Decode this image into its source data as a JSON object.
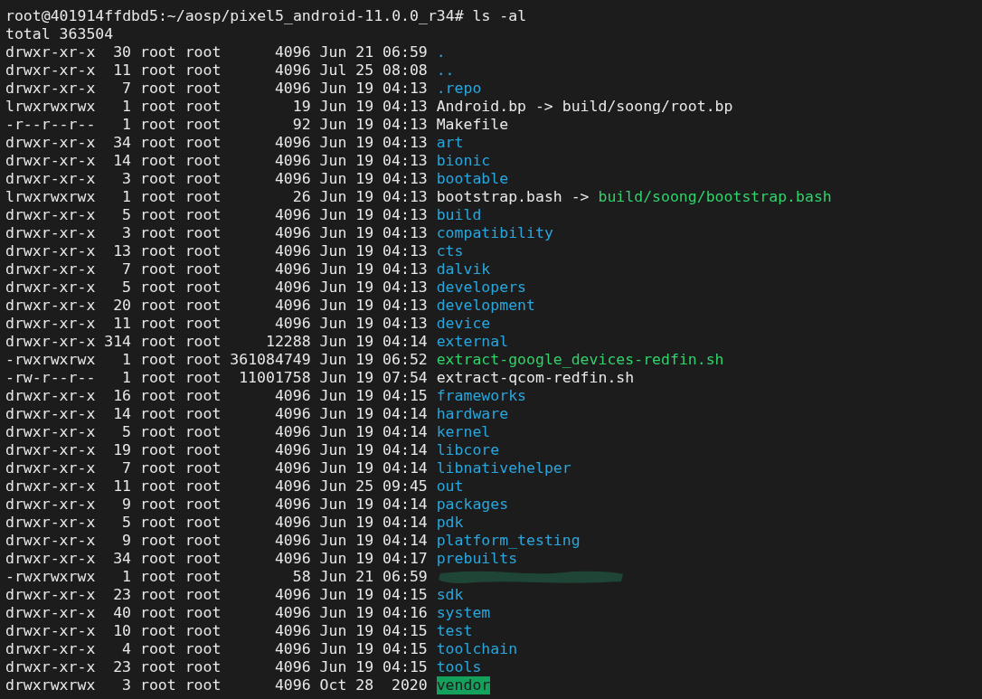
{
  "prompt": {
    "text": "root@401914ffdbd5:~/aosp/pixel5_android-11.0.0_r34#",
    "command": "ls -al"
  },
  "total": "total 363504",
  "entries": [
    {
      "perms": "drwxr-xr-x",
      "links": "30",
      "owner": "root",
      "group": "root",
      "size": "4096",
      "month": "Jun",
      "day": "21",
      "time": "06:59",
      "name": ".",
      "kind": "dir"
    },
    {
      "perms": "drwxr-xr-x",
      "links": "11",
      "owner": "root",
      "group": "root",
      "size": "4096",
      "month": "Jul",
      "day": "25",
      "time": "08:08",
      "name": "..",
      "kind": "dir"
    },
    {
      "perms": "drwxr-xr-x",
      "links": "7",
      "owner": "root",
      "group": "root",
      "size": "4096",
      "month": "Jun",
      "day": "19",
      "time": "04:13",
      "name": ".repo",
      "kind": "dir"
    },
    {
      "perms": "lrwxrwxrwx",
      "links": "1",
      "owner": "root",
      "group": "root",
      "size": "19",
      "month": "Jun",
      "day": "19",
      "time": "04:13",
      "name": "Android.bp",
      "arrow": "->",
      "target": "build/soong/root.bp",
      "target_executable": false,
      "kind": "link"
    },
    {
      "perms": "-r--r--r--",
      "links": "1",
      "owner": "root",
      "group": "root",
      "size": "92",
      "month": "Jun",
      "day": "19",
      "time": "04:13",
      "name": "Makefile",
      "kind": "file"
    },
    {
      "perms": "drwxr-xr-x",
      "links": "34",
      "owner": "root",
      "group": "root",
      "size": "4096",
      "month": "Jun",
      "day": "19",
      "time": "04:13",
      "name": "art",
      "kind": "dir"
    },
    {
      "perms": "drwxr-xr-x",
      "links": "14",
      "owner": "root",
      "group": "root",
      "size": "4096",
      "month": "Jun",
      "day": "19",
      "time": "04:13",
      "name": "bionic",
      "kind": "dir"
    },
    {
      "perms": "drwxr-xr-x",
      "links": "3",
      "owner": "root",
      "group": "root",
      "size": "4096",
      "month": "Jun",
      "day": "19",
      "time": "04:13",
      "name": "bootable",
      "kind": "dir"
    },
    {
      "perms": "lrwxrwxrwx",
      "links": "1",
      "owner": "root",
      "group": "root",
      "size": "26",
      "month": "Jun",
      "day": "19",
      "time": "04:13",
      "name": "bootstrap.bash",
      "arrow": "->",
      "target": "build/soong/bootstrap.bash",
      "target_executable": true,
      "kind": "link"
    },
    {
      "perms": "drwxr-xr-x",
      "links": "5",
      "owner": "root",
      "group": "root",
      "size": "4096",
      "month": "Jun",
      "day": "19",
      "time": "04:13",
      "name": "build",
      "kind": "dir"
    },
    {
      "perms": "drwxr-xr-x",
      "links": "3",
      "owner": "root",
      "group": "root",
      "size": "4096",
      "month": "Jun",
      "day": "19",
      "time": "04:13",
      "name": "compatibility",
      "kind": "dir"
    },
    {
      "perms": "drwxr-xr-x",
      "links": "13",
      "owner": "root",
      "group": "root",
      "size": "4096",
      "month": "Jun",
      "day": "19",
      "time": "04:13",
      "name": "cts",
      "kind": "dir"
    },
    {
      "perms": "drwxr-xr-x",
      "links": "7",
      "owner": "root",
      "group": "root",
      "size": "4096",
      "month": "Jun",
      "day": "19",
      "time": "04:13",
      "name": "dalvik",
      "kind": "dir"
    },
    {
      "perms": "drwxr-xr-x",
      "links": "5",
      "owner": "root",
      "group": "root",
      "size": "4096",
      "month": "Jun",
      "day": "19",
      "time": "04:13",
      "name": "developers",
      "kind": "dir"
    },
    {
      "perms": "drwxr-xr-x",
      "links": "20",
      "owner": "root",
      "group": "root",
      "size": "4096",
      "month": "Jun",
      "day": "19",
      "time": "04:13",
      "name": "development",
      "kind": "dir"
    },
    {
      "perms": "drwxr-xr-x",
      "links": "11",
      "owner": "root",
      "group": "root",
      "size": "4096",
      "month": "Jun",
      "day": "19",
      "time": "04:13",
      "name": "device",
      "kind": "dir"
    },
    {
      "perms": "drwxr-xr-x",
      "links": "314",
      "owner": "root",
      "group": "root",
      "size": "12288",
      "month": "Jun",
      "day": "19",
      "time": "04:14",
      "name": "external",
      "kind": "dir"
    },
    {
      "perms": "-rwxrwxrwx",
      "links": "1",
      "owner": "root",
      "group": "root",
      "size": "361084749",
      "month": "Jun",
      "day": "19",
      "time": "06:52",
      "name": "extract-google_devices-redfin.sh",
      "kind": "exec"
    },
    {
      "perms": "-rw-r--r--",
      "links": "1",
      "owner": "root",
      "group": "root",
      "size": "11001758",
      "month": "Jun",
      "day": "19",
      "time": "07:54",
      "name": "extract-qcom-redfin.sh",
      "kind": "file"
    },
    {
      "perms": "drwxr-xr-x",
      "links": "16",
      "owner": "root",
      "group": "root",
      "size": "4096",
      "month": "Jun",
      "day": "19",
      "time": "04:15",
      "name": "frameworks",
      "kind": "dir"
    },
    {
      "perms": "drwxr-xr-x",
      "links": "14",
      "owner": "root",
      "group": "root",
      "size": "4096",
      "month": "Jun",
      "day": "19",
      "time": "04:14",
      "name": "hardware",
      "kind": "dir"
    },
    {
      "perms": "drwxr-xr-x",
      "links": "5",
      "owner": "root",
      "group": "root",
      "size": "4096",
      "month": "Jun",
      "day": "19",
      "time": "04:14",
      "name": "kernel",
      "kind": "dir"
    },
    {
      "perms": "drwxr-xr-x",
      "links": "19",
      "owner": "root",
      "group": "root",
      "size": "4096",
      "month": "Jun",
      "day": "19",
      "time": "04:14",
      "name": "libcore",
      "kind": "dir"
    },
    {
      "perms": "drwxr-xr-x",
      "links": "7",
      "owner": "root",
      "group": "root",
      "size": "4096",
      "month": "Jun",
      "day": "19",
      "time": "04:14",
      "name": "libnativehelper",
      "kind": "dir"
    },
    {
      "perms": "drwxr-xr-x",
      "links": "11",
      "owner": "root",
      "group": "root",
      "size": "4096",
      "month": "Jun",
      "day": "25",
      "time": "09:45",
      "name": "out",
      "kind": "dir"
    },
    {
      "perms": "drwxr-xr-x",
      "links": "9",
      "owner": "root",
      "group": "root",
      "size": "4096",
      "month": "Jun",
      "day": "19",
      "time": "04:14",
      "name": "packages",
      "kind": "dir"
    },
    {
      "perms": "drwxr-xr-x",
      "links": "5",
      "owner": "root",
      "group": "root",
      "size": "4096",
      "month": "Jun",
      "day": "19",
      "time": "04:14",
      "name": "pdk",
      "kind": "dir"
    },
    {
      "perms": "drwxr-xr-x",
      "links": "9",
      "owner": "root",
      "group": "root",
      "size": "4096",
      "month": "Jun",
      "day": "19",
      "time": "04:14",
      "name": "platform_testing",
      "kind": "dir"
    },
    {
      "perms": "drwxr-xr-x",
      "links": "34",
      "owner": "root",
      "group": "root",
      "size": "4096",
      "month": "Jun",
      "day": "19",
      "time": "04:17",
      "name": "prebuilts",
      "kind": "dir"
    },
    {
      "perms": "-rwxrwxrwx",
      "links": "1",
      "owner": "root",
      "group": "root",
      "size": "58",
      "month": "Jun",
      "day": "21",
      "time": "06:59",
      "kind": "redacted"
    },
    {
      "perms": "drwxr-xr-x",
      "links": "23",
      "owner": "root",
      "group": "root",
      "size": "4096",
      "month": "Jun",
      "day": "19",
      "time": "04:15",
      "name": "sdk",
      "kind": "dir"
    },
    {
      "perms": "drwxr-xr-x",
      "links": "40",
      "owner": "root",
      "group": "root",
      "size": "4096",
      "month": "Jun",
      "day": "19",
      "time": "04:16",
      "name": "system",
      "kind": "dir"
    },
    {
      "perms": "drwxr-xr-x",
      "links": "10",
      "owner": "root",
      "group": "root",
      "size": "4096",
      "month": "Jun",
      "day": "19",
      "time": "04:15",
      "name": "test",
      "kind": "dir"
    },
    {
      "perms": "drwxr-xr-x",
      "links": "4",
      "owner": "root",
      "group": "root",
      "size": "4096",
      "month": "Jun",
      "day": "19",
      "time": "04:15",
      "name": "toolchain",
      "kind": "dir"
    },
    {
      "perms": "drwxr-xr-x",
      "links": "23",
      "owner": "root",
      "group": "root",
      "size": "4096",
      "month": "Jun",
      "day": "19",
      "time": "04:15",
      "name": "tools",
      "kind": "dir"
    },
    {
      "perms": "drwxrwxrwx",
      "links": "3",
      "owner": "root",
      "group": "root",
      "size": "4096",
      "month": "Oct",
      "day": "28",
      "time": "2020",
      "name": "vendor",
      "kind": "open_dir"
    }
  ]
}
